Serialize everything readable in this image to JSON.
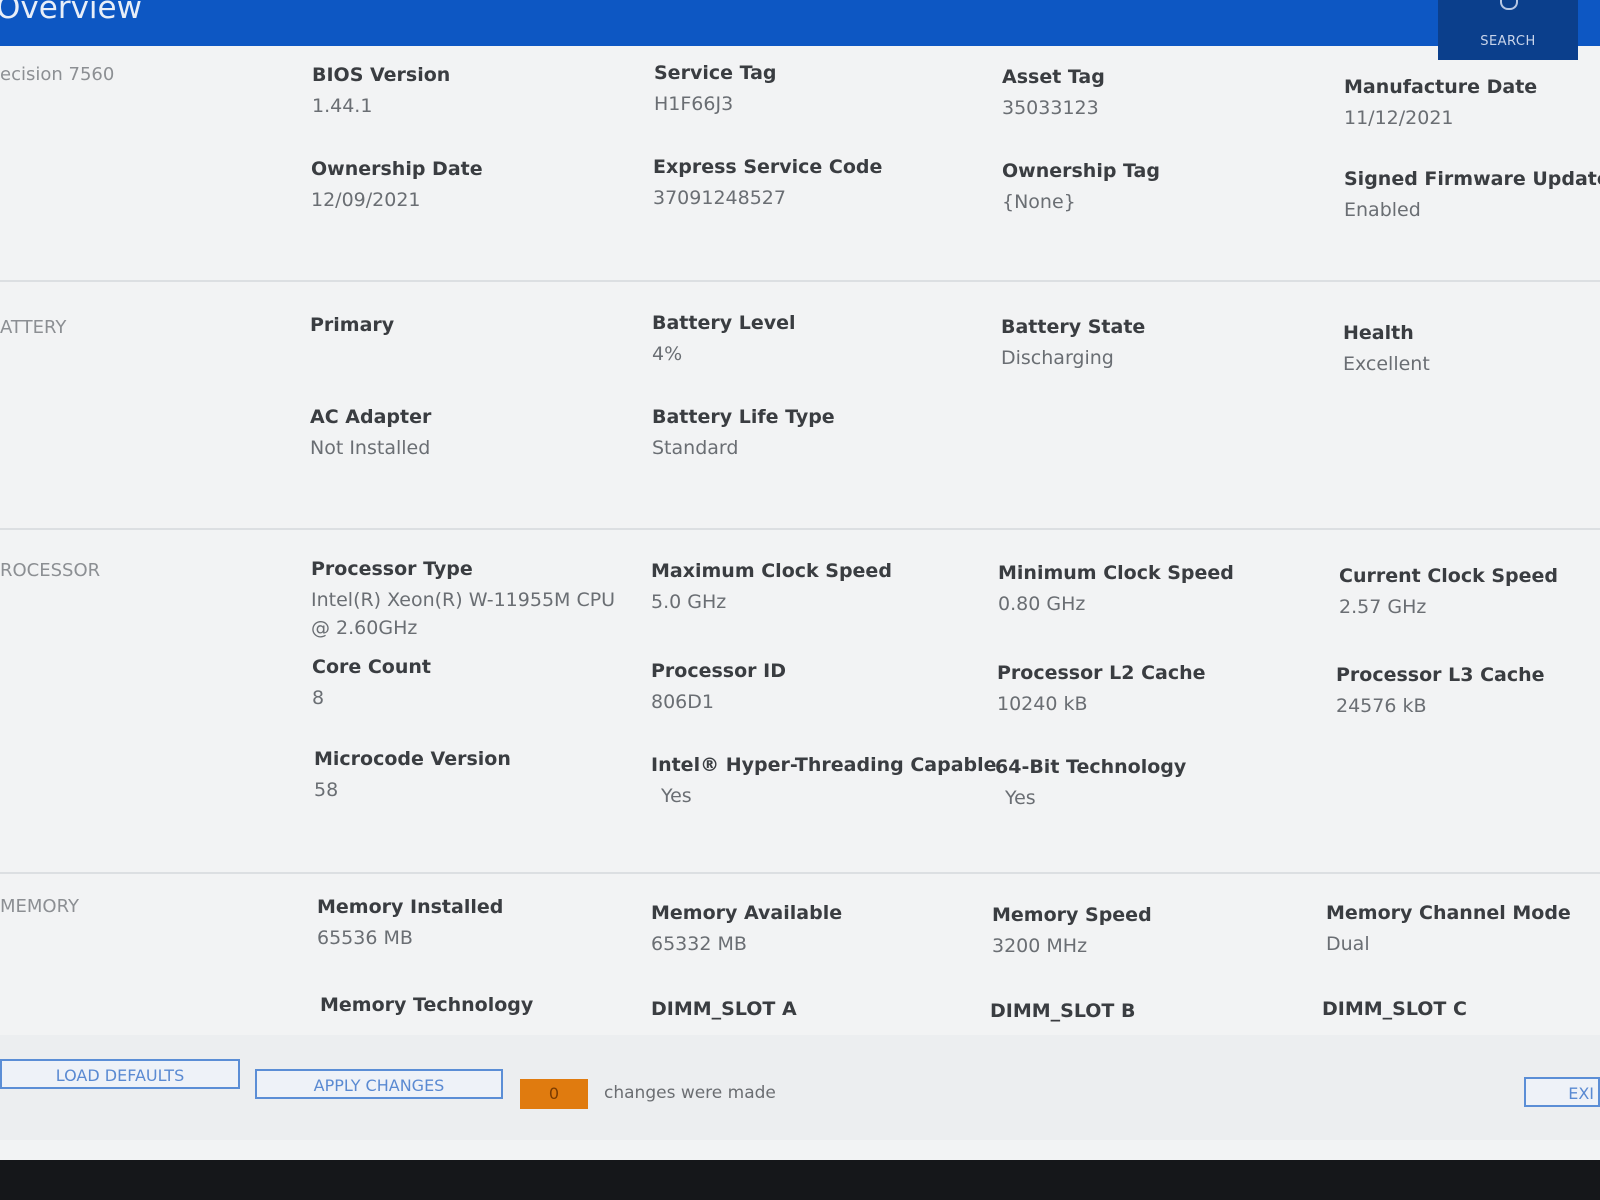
{
  "header": {
    "title": "Overview",
    "search_label": "SEARCH"
  },
  "system": {
    "label": "ecision 7560",
    "bios_version": {
      "key": "BIOS Version",
      "value": "1.44.1"
    },
    "service_tag": {
      "key": "Service Tag",
      "value": "H1F66J3"
    },
    "asset_tag": {
      "key": "Asset Tag",
      "value": "35033123"
    },
    "manufacture_date": {
      "key": "Manufacture Date",
      "value": "11/12/2021"
    },
    "ownership_date": {
      "key": "Ownership Date",
      "value": "12/09/2021"
    },
    "express_service_code": {
      "key": "Express Service Code",
      "value": "37091248527"
    },
    "ownership_tag": {
      "key": "Ownership Tag",
      "value": "{None}"
    },
    "signed_firmware_update": {
      "key": "Signed Firmware Update",
      "value": "Enabled"
    }
  },
  "battery": {
    "label": "ATTERY",
    "primary": {
      "key": "Primary"
    },
    "battery_level": {
      "key": "Battery Level",
      "value": "4%"
    },
    "battery_state": {
      "key": "Battery State",
      "value": "Discharging"
    },
    "health": {
      "key": "Health",
      "value": "Excellent"
    },
    "ac_adapter": {
      "key": "AC Adapter",
      "value": "Not Installed"
    },
    "battery_life_type": {
      "key": "Battery Life Type",
      "value": "Standard"
    }
  },
  "processor": {
    "label": "ROCESSOR",
    "processor_type": {
      "key": "Processor Type",
      "value": "Intel(R) Xeon(R) W-11955M CPU @ 2.60GHz"
    },
    "max_clock": {
      "key": "Maximum Clock Speed",
      "value": "5.0 GHz"
    },
    "min_clock": {
      "key": "Minimum Clock Speed",
      "value": "0.80 GHz"
    },
    "current_clock": {
      "key": "Current Clock Speed",
      "value": "2.57 GHz"
    },
    "core_count": {
      "key": "Core Count",
      "value": "8"
    },
    "processor_id": {
      "key": "Processor ID",
      "value": "806D1"
    },
    "l2_cache": {
      "key": "Processor L2 Cache",
      "value": "10240 kB"
    },
    "l3_cache": {
      "key": "Processor L3 Cache",
      "value": "24576 kB"
    },
    "microcode": {
      "key": "Microcode Version",
      "value": "58"
    },
    "hyperthreading": {
      "key": "Intel® Hyper-Threading Capable",
      "value": "Yes"
    },
    "bit64": {
      "key": "64-Bit Technology",
      "value": "Yes"
    }
  },
  "memory": {
    "label": "MEMORY",
    "installed": {
      "key": "Memory Installed",
      "value": "65536 MB"
    },
    "available": {
      "key": "Memory Available",
      "value": "65332 MB"
    },
    "speed": {
      "key": "Memory Speed",
      "value": "3200 MHz"
    },
    "channel_mode": {
      "key": "Memory Channel Mode",
      "value": "Dual"
    },
    "technology": {
      "key": "Memory Technology"
    },
    "dimm_a": {
      "key": "DIMM_SLOT A"
    },
    "dimm_b": {
      "key": "DIMM_SLOT B"
    },
    "dimm_c": {
      "key": "DIMM_SLOT C"
    }
  },
  "footer": {
    "load_defaults": "LOAD DEFAULTS",
    "apply_changes": "APPLY CHANGES",
    "change_count": "0",
    "changes_text": "changes were made",
    "exit": "EXI"
  },
  "colors": {
    "header_bg": "#0d57c3",
    "counter_bg": "#e07b0f",
    "button_border": "#5b8ed6"
  }
}
